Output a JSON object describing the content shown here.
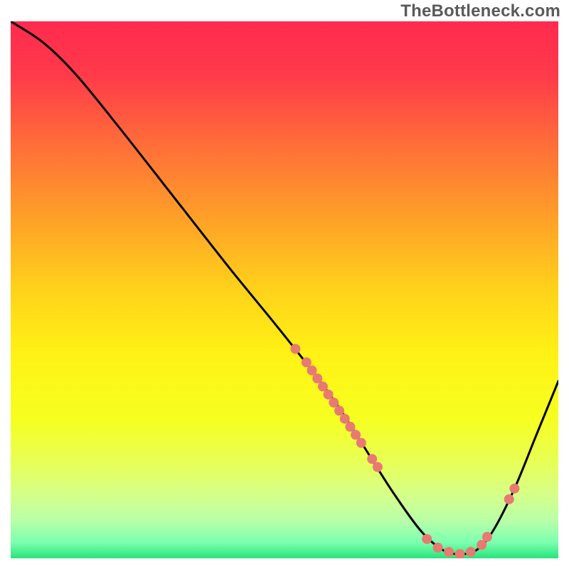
{
  "watermark": "TheBottleneck.com",
  "chart_data": {
    "type": "line",
    "title": "",
    "xlabel": "",
    "ylabel": "",
    "xlim": [
      0,
      100
    ],
    "ylim": [
      0,
      100
    ],
    "curve": [
      {
        "x": 0,
        "y": 100
      },
      {
        "x": 6,
        "y": 96
      },
      {
        "x": 12,
        "y": 90
      },
      {
        "x": 20,
        "y": 80
      },
      {
        "x": 30,
        "y": 67
      },
      {
        "x": 40,
        "y": 54
      },
      {
        "x": 48,
        "y": 44
      },
      {
        "x": 55,
        "y": 35
      },
      {
        "x": 60,
        "y": 28
      },
      {
        "x": 65,
        "y": 20
      },
      {
        "x": 70,
        "y": 12
      },
      {
        "x": 75,
        "y": 5
      },
      {
        "x": 79,
        "y": 1.5
      },
      {
        "x": 82,
        "y": 0.8
      },
      {
        "x": 85,
        "y": 1.5
      },
      {
        "x": 88,
        "y": 5
      },
      {
        "x": 92,
        "y": 13
      },
      {
        "x": 96,
        "y": 23
      },
      {
        "x": 100,
        "y": 33
      }
    ],
    "markers": [
      {
        "x": 52,
        "y": 39
      },
      {
        "x": 54,
        "y": 36.5
      },
      {
        "x": 55,
        "y": 35
      },
      {
        "x": 56,
        "y": 33.5
      },
      {
        "x": 57,
        "y": 32
      },
      {
        "x": 58,
        "y": 30.5
      },
      {
        "x": 59,
        "y": 29
      },
      {
        "x": 60,
        "y": 27.5
      },
      {
        "x": 61,
        "y": 26
      },
      {
        "x": 62,
        "y": 24.5
      },
      {
        "x": 63,
        "y": 23
      },
      {
        "x": 64,
        "y": 21.5
      },
      {
        "x": 66,
        "y": 18.5
      },
      {
        "x": 67,
        "y": 17
      },
      {
        "x": 76,
        "y": 3.6
      },
      {
        "x": 78,
        "y": 2
      },
      {
        "x": 80,
        "y": 1.2
      },
      {
        "x": 82,
        "y": 0.8
      },
      {
        "x": 84,
        "y": 1.2
      },
      {
        "x": 86,
        "y": 2.5
      },
      {
        "x": 87,
        "y": 4
      },
      {
        "x": 91,
        "y": 11
      },
      {
        "x": 92,
        "y": 13
      }
    ],
    "gradient_stops": [
      {
        "offset": 0.0,
        "color": "#ff2a4f"
      },
      {
        "offset": 0.1,
        "color": "#ff3a4a"
      },
      {
        "offset": 0.22,
        "color": "#ff6a3a"
      },
      {
        "offset": 0.35,
        "color": "#ff9a2a"
      },
      {
        "offset": 0.5,
        "color": "#ffd21a"
      },
      {
        "offset": 0.62,
        "color": "#fff215"
      },
      {
        "offset": 0.74,
        "color": "#f6ff20"
      },
      {
        "offset": 0.82,
        "color": "#e8ff55"
      },
      {
        "offset": 0.88,
        "color": "#d6ff88"
      },
      {
        "offset": 0.93,
        "color": "#b8ffa8"
      },
      {
        "offset": 0.97,
        "color": "#7dffb0"
      },
      {
        "offset": 1.0,
        "color": "#28e57a"
      }
    ],
    "marker_color": "#e87a72",
    "curve_color": "#000000"
  }
}
